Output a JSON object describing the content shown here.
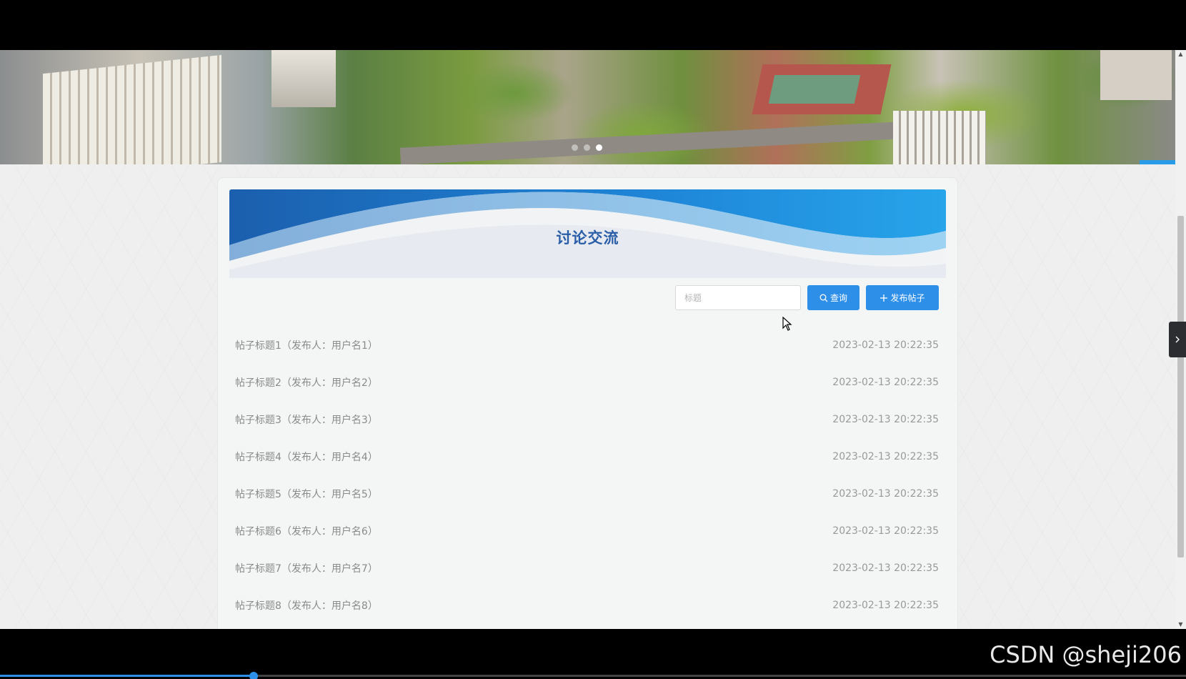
{
  "section": {
    "title": "讨论交流"
  },
  "search": {
    "placeholder": "标题",
    "value": ""
  },
  "toolbar": {
    "query_label": "查询",
    "publish_label": "发布帖子"
  },
  "carousel": {
    "slide_count": 3,
    "active_slide": 3
  },
  "posts": [
    {
      "title": "帖子标题1（发布人：用户名1）",
      "date": "2023-02-13 20:22:35"
    },
    {
      "title": "帖子标题2（发布人：用户名2）",
      "date": "2023-02-13 20:22:35"
    },
    {
      "title": "帖子标题3（发布人：用户名3）",
      "date": "2023-02-13 20:22:35"
    },
    {
      "title": "帖子标题4（发布人：用户名4）",
      "date": "2023-02-13 20:22:35"
    },
    {
      "title": "帖子标题5（发布人：用户名5）",
      "date": "2023-02-13 20:22:35"
    },
    {
      "title": "帖子标题6（发布人：用户名6）",
      "date": "2023-02-13 20:22:35"
    },
    {
      "title": "帖子标题7（发布人：用户名7）",
      "date": "2023-02-13 20:22:35"
    },
    {
      "title": "帖子标题8（发布人：用户名8）",
      "date": "2023-02-13 20:22:35"
    }
  ],
  "icons": {
    "query": "search-icon",
    "publish": "plus-icon",
    "side_tab": "chevron-right-icon"
  },
  "colors": {
    "accent": "#2e8fe8",
    "title": "#2a5da8"
  },
  "watermark": "CSDN @sheji206"
}
